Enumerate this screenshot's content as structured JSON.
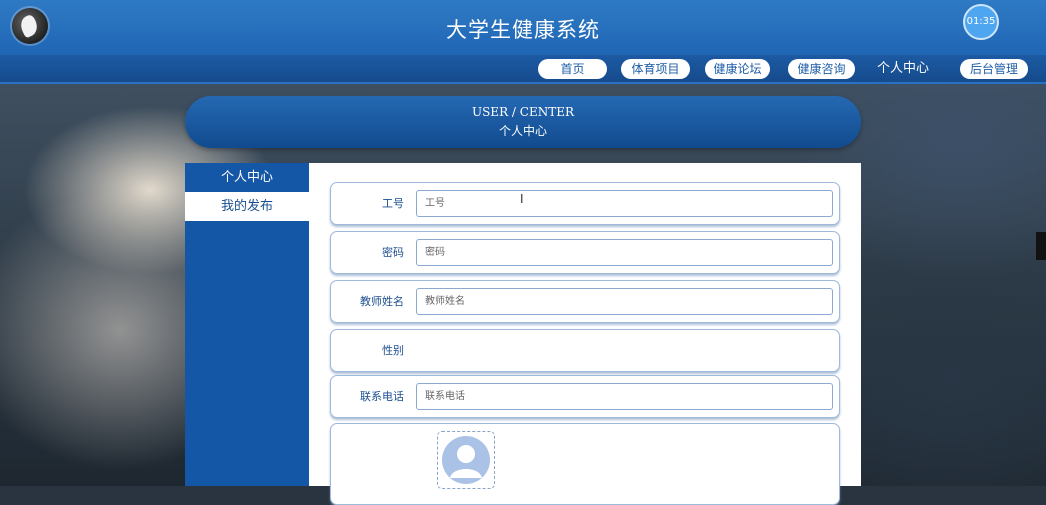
{
  "header": {
    "title": "大学生健康系统",
    "clock": "01:35"
  },
  "nav": {
    "items": [
      "首页",
      "体育项目",
      "健康论坛",
      "健康咨询"
    ],
    "active": "个人中心",
    "admin": "后台管理"
  },
  "banner": {
    "en": "USER / CENTER",
    "cn": "个人中心"
  },
  "sidebar": {
    "items": [
      "个人中心",
      "我的发布"
    ]
  },
  "form": {
    "fields": [
      {
        "label": "工号",
        "placeholder": "工号"
      },
      {
        "label": "密码",
        "placeholder": "密码"
      },
      {
        "label": "教师姓名",
        "placeholder": "教师姓名"
      },
      {
        "label": "性别"
      },
      {
        "label": "联系电话",
        "placeholder": "联系电话"
      }
    ]
  },
  "colors": {
    "primary": "#1f66b5",
    "dark_blue": "#114a8e",
    "accent": "#4fa6f0"
  }
}
